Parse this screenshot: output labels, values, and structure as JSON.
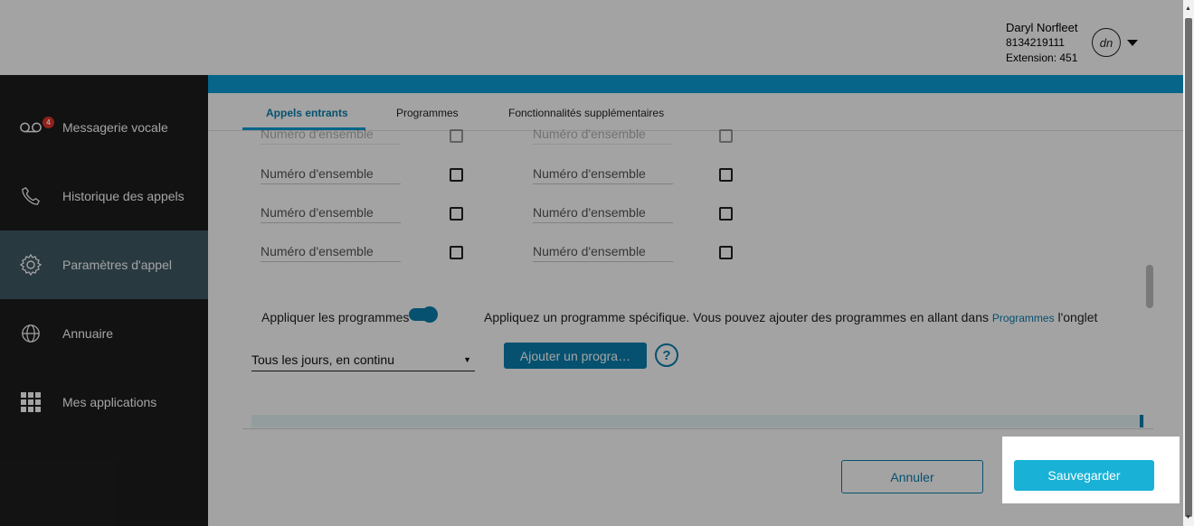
{
  "user": {
    "name": "Daryl Norfleet",
    "phone": "8134219111",
    "extension": "Extension: 451",
    "initials": "dn"
  },
  "sidebar": {
    "items": [
      {
        "label": "Messagerie vocale",
        "icon": "voicemail-icon",
        "badge": "4"
      },
      {
        "label": "Historique des appels",
        "icon": "phone-icon"
      },
      {
        "label": "Paramètres d'appel",
        "icon": "gear-icon",
        "active": true
      },
      {
        "label": "Annuaire",
        "icon": "globe-icon"
      },
      {
        "label": "Mes applications",
        "icon": "grid-icon"
      }
    ]
  },
  "tabs": [
    {
      "label": "Appels entrants",
      "active": true
    },
    {
      "label": "Programmes"
    },
    {
      "label": "Fonctionnalités supplémentaires"
    }
  ],
  "form": {
    "field_placeholder": "Numéro d'ensemble",
    "apply_label": "Appliquer les programmes",
    "apply_toggle_on": true,
    "apply_desc_before": "Appliquez un programme spécifique. Vous pouvez ajouter des programmes en allant dans ",
    "apply_desc_link": "Programmes",
    "apply_desc_after": " l'onglet",
    "schedule_value": "Tous les jours, en continu",
    "add_button": "Ajouter un progra…",
    "help": "?"
  },
  "actions": {
    "cancel": "Annuler",
    "save": "Sauvegarder"
  },
  "colors": {
    "accent": "#0a7fb0",
    "save": "#19b2d6",
    "sidebar": "#1d1d1d",
    "sidebar_active": "#3f5965",
    "badge": "#e4322b"
  }
}
